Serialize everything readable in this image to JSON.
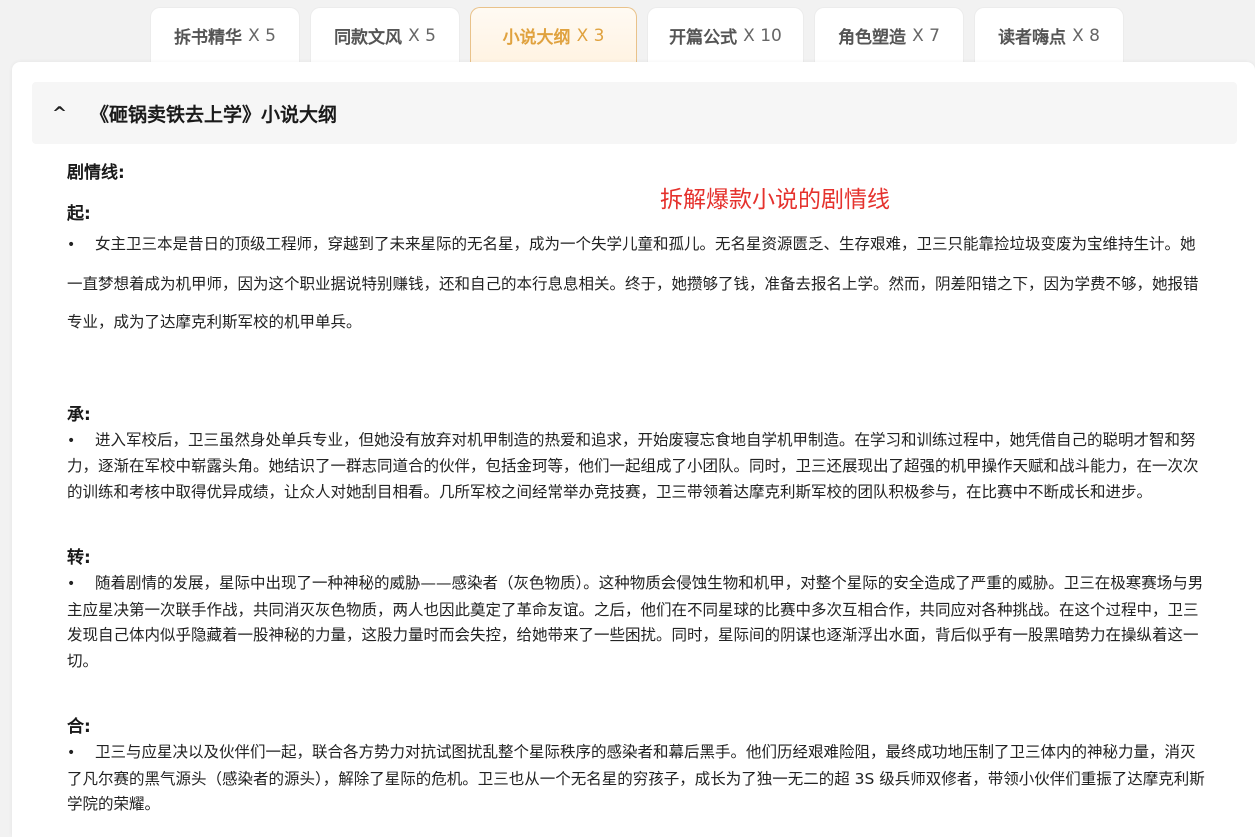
{
  "tabs": [
    {
      "label": "拆书精华",
      "count": "X 5",
      "active": false
    },
    {
      "label": "同款文风",
      "count": "X 5",
      "active": false
    },
    {
      "label": "小说大纲",
      "count": "X 3",
      "active": true
    },
    {
      "label": "开篇公式",
      "count": "X 10",
      "active": false
    },
    {
      "label": "角色塑造",
      "count": "X 7",
      "active": false
    },
    {
      "label": "读者嗨点",
      "count": "X 8",
      "active": false
    }
  ],
  "panel": {
    "collapse_icon": "^",
    "title": "《砸锅卖铁去上学》小说大纲"
  },
  "content": {
    "section_heading": "剧情线:",
    "annotation": "拆解爆款小说的剧情线",
    "bullet_symbol": "•",
    "stages": [
      {
        "label": "起:",
        "text": "女主卫三本是昔日的顶级工程师，穿越到了未来星际的无名星，成为一个失学儿童和孤儿。无名星资源匮乏、生存艰难，卫三只能靠捡垃圾变废为宝维持生计。她一直梦想着成为机甲师，因为这个职业据说特别赚钱，还和自己的本行息息相关。终于，她攒够了钱，准备去报名上学。然而，阴差阳错之下，因为学费不够，她报错专业，成为了达摩克利斯军校的机甲单兵。"
      },
      {
        "label": "承:",
        "text": "进入军校后，卫三虽然身处单兵专业，但她没有放弃对机甲制造的热爱和追求，开始废寝忘食地自学机甲制造。在学习和训练过程中，她凭借自己的聪明才智和努力，逐渐在军校中崭露头角。她结识了一群志同道合的伙伴，包括金珂等，他们一起组成了小团队。同时，卫三还展现出了超强的机甲操作天赋和战斗能力，在一次次的训练和考核中取得优异成绩，让众人对她刮目相看。几所军校之间经常举办竞技赛，卫三带领着达摩克利斯军校的团队积极参与，在比赛中不断成长和进步。"
      },
      {
        "label": "转:",
        "text": "随着剧情的发展，星际中出现了一种神秘的威胁——感染者（灰色物质）。这种物质会侵蚀生物和机甲，对整个星际的安全造成了严重的威胁。卫三在极寒赛场与男主应星决第一次联手作战，共同消灭灰色物质，两人也因此奠定了革命友谊。之后，他们在不同星球的比赛中多次互相合作，共同应对各种挑战。在这个过程中，卫三发现自己体内似乎隐藏着一股神秘的力量，这股力量时而会失控，给她带来了一些困扰。同时，星际间的阴谋也逐渐浮出水面，背后似乎有一股黑暗势力在操纵着这一切。"
      },
      {
        "label": "合:",
        "text": "卫三与应星决以及伙伴们一起，联合各方势力对抗试图扰乱整个星际秩序的感染者和幕后黑手。他们历经艰难险阻，最终成功地压制了卫三体内的神秘力量，消灭了凡尔赛的黑气源头（感染者的源头），解除了星际的危机。卫三也从一个无名星的穷孩子，成长为了独一无二的超 3S 级兵师双修者，带领小伙伴们重振了达摩克利斯学院的荣耀。"
      }
    ]
  },
  "colors": {
    "accent": "#e0a23f",
    "annotation": "#e5322d"
  }
}
